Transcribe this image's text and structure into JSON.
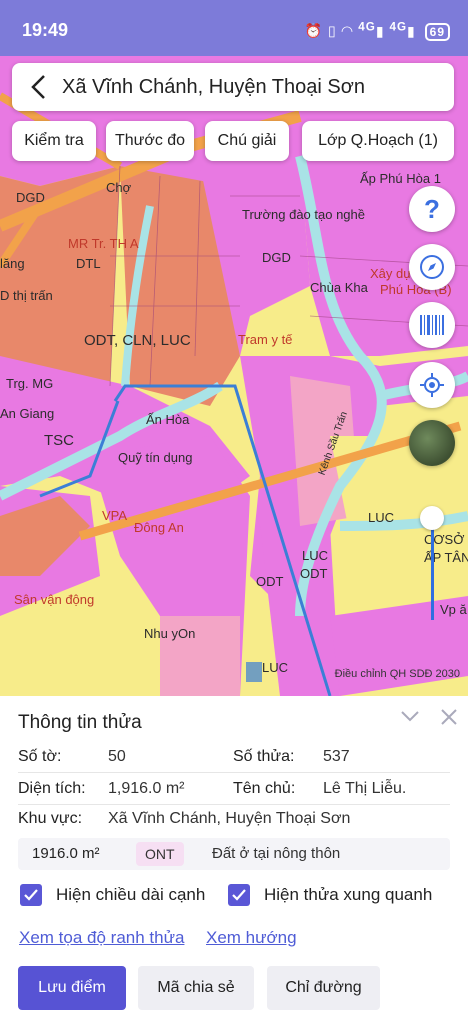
{
  "status_bar": {
    "time": "19:49",
    "icons": [
      "alarm-icon",
      "vibrate-icon",
      "wifi-icon",
      "signal-4g-icon",
      "signal-4g-icon"
    ],
    "network_a": "4G",
    "network_b": "4G",
    "battery": "69"
  },
  "header": {
    "title": "Xã Vĩnh Chánh, Huyện Thoại Sơn"
  },
  "tools": {
    "inspect": "Kiểm tra",
    "measure": "Thước đo",
    "legend": "Chú giải",
    "layers": "Lớp Q.Hoạch (1)"
  },
  "map": {
    "labels": {
      "dgd": "DGD",
      "cho": "Chợ",
      "tr_th": "MR Tr. TH A",
      "truong": "Trường đào tạo nghề",
      "phu_hoa": "Ấp Phú Hòa 1",
      "dgd2": "DGD",
      "dtl": "DTL",
      "lang": "lăng",
      "thi_tran": "D thị trấn",
      "xay_dung": "Xây dựng",
      "chua_kha": "Chùa Kha",
      "phu_hoa_b": "Phú Hòa (B)",
      "odt_cln": "ODT, CLN, LUC",
      "tram_y_te": "Tram y tế",
      "trg_mg": "Trg. MG",
      "an_giang": "An Giang",
      "an_hoa": "Ấn Hòa",
      "tsc": "TSC",
      "quy_tin_dung": "Quỹ tín dụng",
      "kenh": "Kênh Sầu Trấn",
      "dong_an": "Đông An",
      "vpa": "VPA",
      "luc1": "LUC",
      "luc2": "LUC",
      "odt1": "ODT",
      "odt2": "ODT",
      "coso": "CƠSỞ N",
      "ap_tan": "ẤP TÂN",
      "san_van_dong": "Sân vận động",
      "nhu_yon": "Nhu yOn",
      "luc3": "LUC",
      "vp_a": "Vp ă"
    },
    "attribution": "Điều chỉnh QH SDĐ 2030",
    "colors": {
      "residential": "#e879e2",
      "commercial": "#f3a5c6",
      "rice": "#f7ec8a",
      "urban": "#e8886a",
      "water": "#a9e3e6",
      "road": "#f2a24a",
      "boundary": "#3b7fd6"
    },
    "controls": [
      "help-icon",
      "compass-icon",
      "barcode-icon",
      "locate-icon",
      "satellite-thumb",
      "opacity-slider"
    ]
  },
  "sheet": {
    "title": "Thông tin thửa",
    "to_label": "Số tờ:",
    "to_value": "50",
    "thua_label": "Số thửa:",
    "thua_value": "537",
    "area_label": "Diện tích:",
    "area_value": "1,916.0 m²",
    "owner_label": "Tên chủ:",
    "owner_value": "Lê Thị Liễu.",
    "region_label": "Khu vực:",
    "region_value": "Xã Vĩnh Chánh, Huyện Thoại Sơn",
    "usage": {
      "area": "1916.0 m²",
      "code": "ONT",
      "description": "Đất ở tại nông thôn"
    },
    "check_edges": "Hiện chiều dài cạnh",
    "check_neighbors": "Hiện thửa xung quanh",
    "link_coords": "Xem tọa độ ranh thửa",
    "link_direction": "Xem hướng",
    "btn_save": "Lưu điểm",
    "btn_share": "Mã chia sẻ",
    "btn_route": "Chỉ đường"
  }
}
